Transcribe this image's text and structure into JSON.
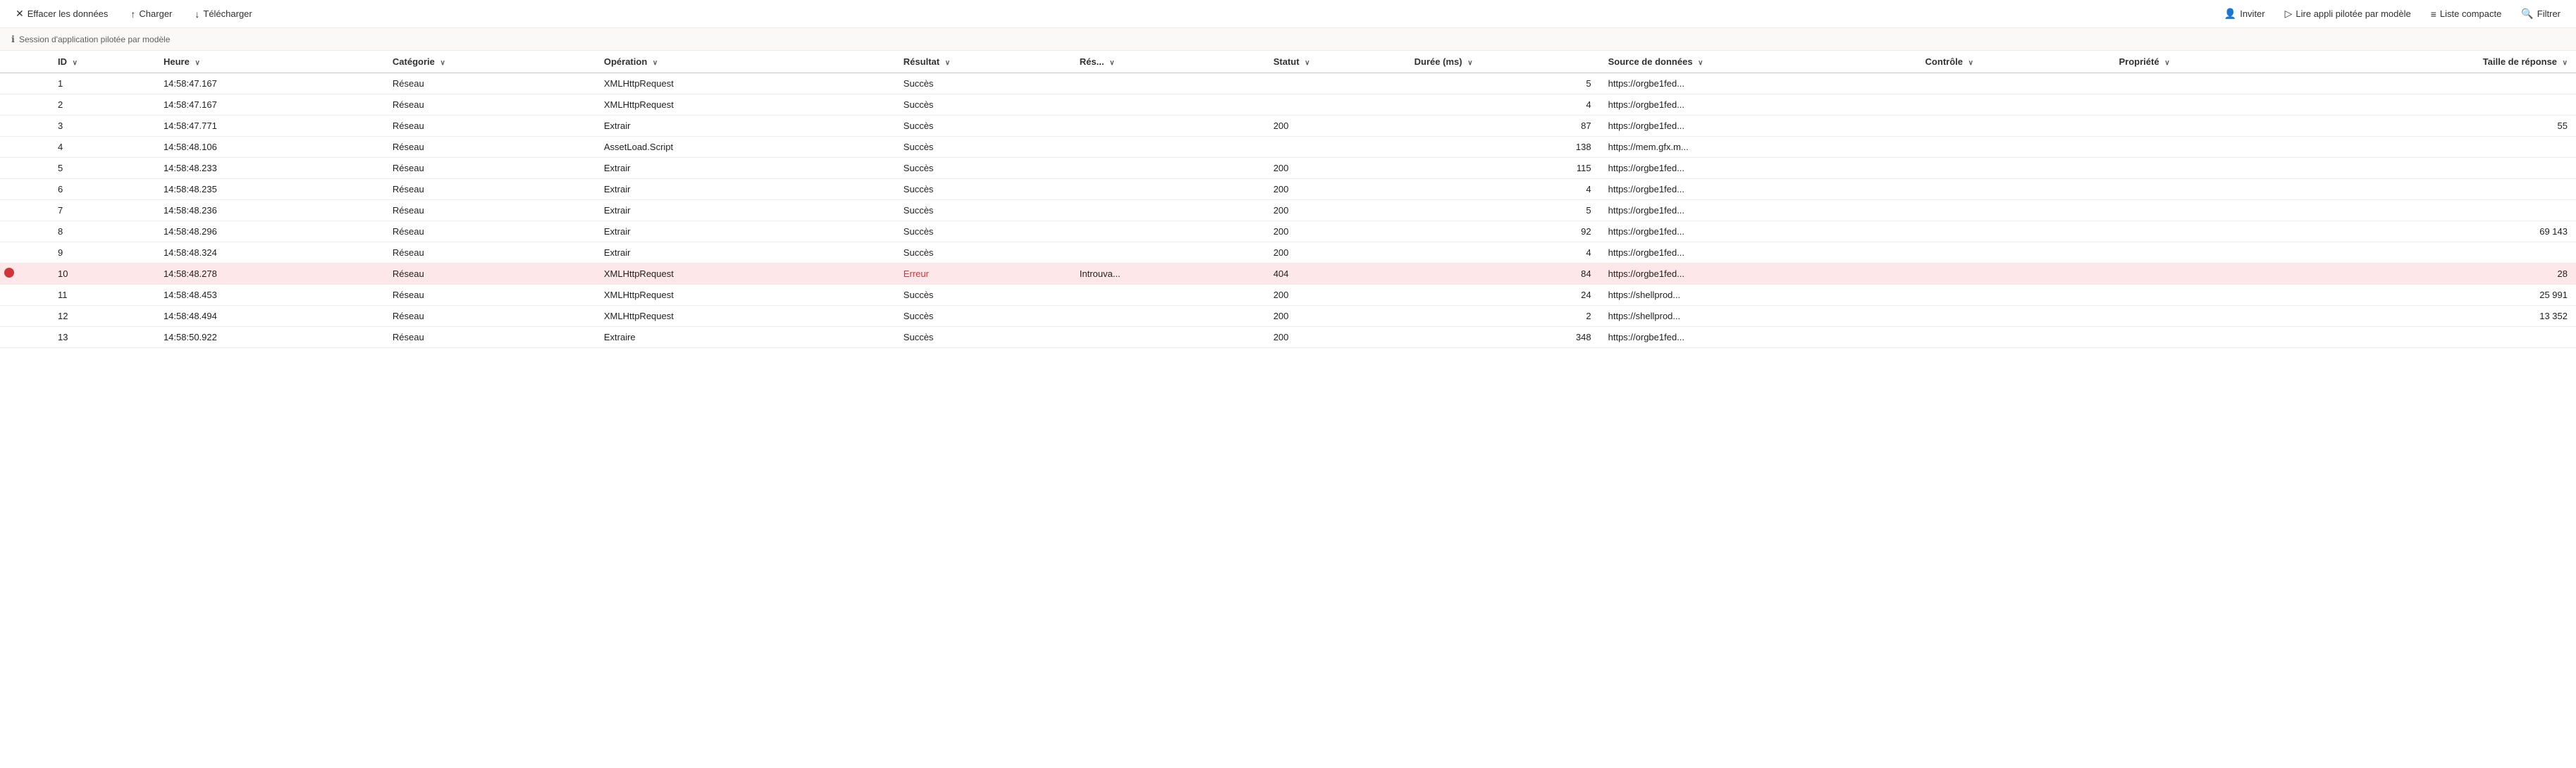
{
  "toolbar": {
    "clear_label": "Effacer les données",
    "load_label": "Charger",
    "download_label": "Télécharger",
    "invite_label": "Inviter",
    "run_label": "Lire appli pilotée par modèle",
    "compact_label": "Liste compacte",
    "filter_label": "Filtrer"
  },
  "session": {
    "text": "Session d'application pilotée par modèle"
  },
  "table": {
    "columns": [
      {
        "id": "indicator",
        "label": ""
      },
      {
        "id": "id",
        "label": "ID"
      },
      {
        "id": "time",
        "label": "Heure"
      },
      {
        "id": "category",
        "label": "Catégorie"
      },
      {
        "id": "operation",
        "label": "Opération"
      },
      {
        "id": "result",
        "label": "Résultat"
      },
      {
        "id": "result2",
        "label": "Rés..."
      },
      {
        "id": "status",
        "label": "Statut"
      },
      {
        "id": "duration",
        "label": "Durée (ms)"
      },
      {
        "id": "datasource",
        "label": "Source de données"
      },
      {
        "id": "control",
        "label": "Contrôle"
      },
      {
        "id": "property",
        "label": "Propriété"
      },
      {
        "id": "size",
        "label": "Taille de réponse"
      }
    ],
    "rows": [
      {
        "id": 1,
        "time": "14:58:47.167",
        "category": "Réseau",
        "operation": "XMLHttpRequest",
        "result": "Succès",
        "result2": "",
        "status": "",
        "duration": "5",
        "datasource": "https://orgbe1fed...",
        "control": "",
        "property": "",
        "size": "",
        "error": false
      },
      {
        "id": 2,
        "time": "14:58:47.167",
        "category": "Réseau",
        "operation": "XMLHttpRequest",
        "result": "Succès",
        "result2": "",
        "status": "",
        "duration": "4",
        "datasource": "https://orgbe1fed...",
        "control": "",
        "property": "",
        "size": "",
        "error": false
      },
      {
        "id": 3,
        "time": "14:58:47.771",
        "category": "Réseau",
        "operation": "Extrair",
        "result": "Succès",
        "result2": "",
        "status": "200",
        "duration": "87",
        "datasource": "https://orgbe1fed...",
        "control": "",
        "property": "",
        "size": "55",
        "error": false
      },
      {
        "id": 4,
        "time": "14:58:48.106",
        "category": "Réseau",
        "operation": "AssetLoad.Script",
        "result": "Succès",
        "result2": "",
        "status": "",
        "duration": "138",
        "datasource": "https://mem.gfx.m...",
        "control": "",
        "property": "",
        "size": "",
        "error": false
      },
      {
        "id": 5,
        "time": "14:58:48.233",
        "category": "Réseau",
        "operation": "Extrair",
        "result": "Succès",
        "result2": "",
        "status": "200",
        "duration": "115",
        "datasource": "https://orgbe1fed...",
        "control": "",
        "property": "",
        "size": "",
        "error": false
      },
      {
        "id": 6,
        "time": "14:58:48.235",
        "category": "Réseau",
        "operation": "Extrair",
        "result": "Succès",
        "result2": "",
        "status": "200",
        "duration": "4",
        "datasource": "https://orgbe1fed...",
        "control": "",
        "property": "",
        "size": "",
        "error": false
      },
      {
        "id": 7,
        "time": "14:58:48.236",
        "category": "Réseau",
        "operation": "Extrair",
        "result": "Succès",
        "result2": "",
        "status": "200",
        "duration": "5",
        "datasource": "https://orgbe1fed...",
        "control": "",
        "property": "",
        "size": "",
        "error": false
      },
      {
        "id": 8,
        "time": "14:58:48.296",
        "category": "Réseau",
        "operation": "Extrair",
        "result": "Succès",
        "result2": "",
        "status": "200",
        "duration": "92",
        "datasource": "https://orgbe1fed...",
        "control": "",
        "property": "",
        "size": "69 143",
        "error": false
      },
      {
        "id": 9,
        "time": "14:58:48.324",
        "category": "Réseau",
        "operation": "Extrair",
        "result": "Succès",
        "result2": "",
        "status": "200",
        "duration": "4",
        "datasource": "https://orgbe1fed...",
        "control": "",
        "property": "",
        "size": "",
        "error": false
      },
      {
        "id": 10,
        "time": "14:58:48.278",
        "category": "Réseau",
        "operation": "XMLHttpRequest",
        "result": "Erreur",
        "result2": "Introuvа...",
        "status": "404",
        "duration": "84",
        "datasource": "https://orgbe1fed...",
        "control": "",
        "property": "",
        "size": "28",
        "error": true
      },
      {
        "id": 11,
        "time": "14:58:48.453",
        "category": "Réseau",
        "operation": "XMLHttpRequest",
        "result": "Succès",
        "result2": "",
        "status": "200",
        "duration": "24",
        "datasource": "https://shellprod...",
        "control": "",
        "property": "",
        "size": "25 991",
        "error": false
      },
      {
        "id": 12,
        "time": "14:58:48.494",
        "category": "Réseau",
        "operation": "XMLHttpRequest",
        "result": "Succès",
        "result2": "",
        "status": "200",
        "duration": "2",
        "datasource": "https://shellprod...",
        "control": "",
        "property": "",
        "size": "13 352",
        "error": false
      },
      {
        "id": 13,
        "time": "14:58:50.922",
        "category": "Réseau",
        "operation": "Extraire",
        "result": "Succès",
        "result2": "",
        "status": "200",
        "duration": "348",
        "datasource": "https://orgbe1fed...",
        "control": "",
        "property": "",
        "size": "",
        "error": false
      }
    ]
  }
}
